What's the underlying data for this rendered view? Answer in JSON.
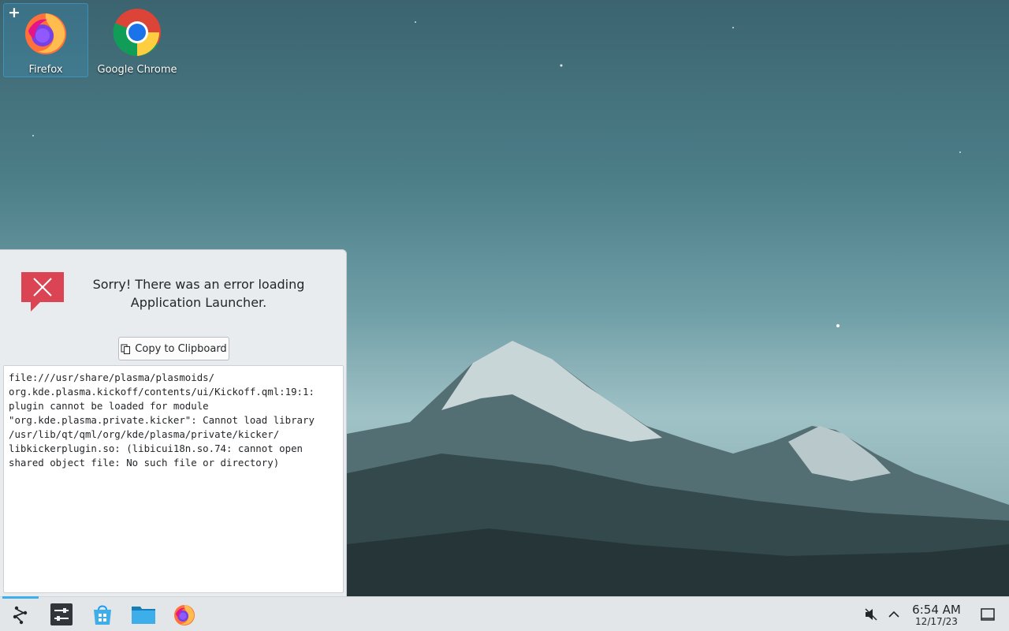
{
  "desktop": {
    "icons": [
      {
        "label": "Firefox",
        "icon": "firefox-icon"
      },
      {
        "label": "Google Chrome",
        "icon": "chrome-icon"
      }
    ],
    "add_badge": "+"
  },
  "launcher_error": {
    "title": "Sorry! There was an error loading Application Launcher.",
    "copy_button": "Copy to Clipboard",
    "details": "file:///usr/share/plasma/plasmoids/\norg.kde.plasma.kickoff/contents/ui/Kickoff.qml:19:1:\nplugin cannot be loaded for module\n\"org.kde.plasma.private.kicker\": Cannot load library\n/usr/lib/qt/qml/org/kde/plasma/private/kicker/\nlibkickerplugin.so: (libicui18n.so.74: cannot open\nshared object file: No such file or directory)"
  },
  "taskbar": {
    "items": [
      "application-launcher-icon",
      "system-settings-icon",
      "discover-store-icon",
      "file-manager-icon",
      "firefox-icon"
    ],
    "tray": [
      "volume-muted-icon",
      "chevron-up-icon"
    ],
    "time": "6:54 AM",
    "date": "12/17/23",
    "show_desktop": "show-desktop-icon"
  },
  "colors": {
    "accent": "#3daee9",
    "error_red": "#da4453",
    "panel": "#e3e6e9"
  }
}
